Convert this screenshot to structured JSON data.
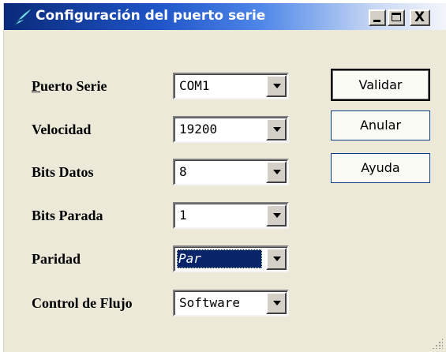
{
  "window": {
    "title": "Configuración del puerto serie",
    "icon": "quill-pen-icon"
  },
  "title_controls": {
    "minimize": "minimize-icon",
    "maximize": "maximize-icon",
    "close_glyph": "X"
  },
  "fields": {
    "port": {
      "label": "Puerto Serie",
      "mnemonic": "P",
      "label_rest": "uerto Serie",
      "value": "COM1"
    },
    "speed": {
      "label": "Velocidad",
      "value": "19200"
    },
    "data_bits": {
      "label": "Bits Datos",
      "value": "8"
    },
    "stop_bits": {
      "label": "Bits Parada",
      "value": "1"
    },
    "parity": {
      "label": "Paridad",
      "value": "Par"
    },
    "flow_control": {
      "label": "Control de Flujo",
      "value": "Software"
    }
  },
  "buttons": {
    "validate": "Validar",
    "cancel": "Anular",
    "help": "Ayuda"
  },
  "colors": {
    "face": "#ece9d8",
    "selection": "#0a246a",
    "title_start": "#0a2a7a",
    "title_end": "#f3f5fb"
  }
}
